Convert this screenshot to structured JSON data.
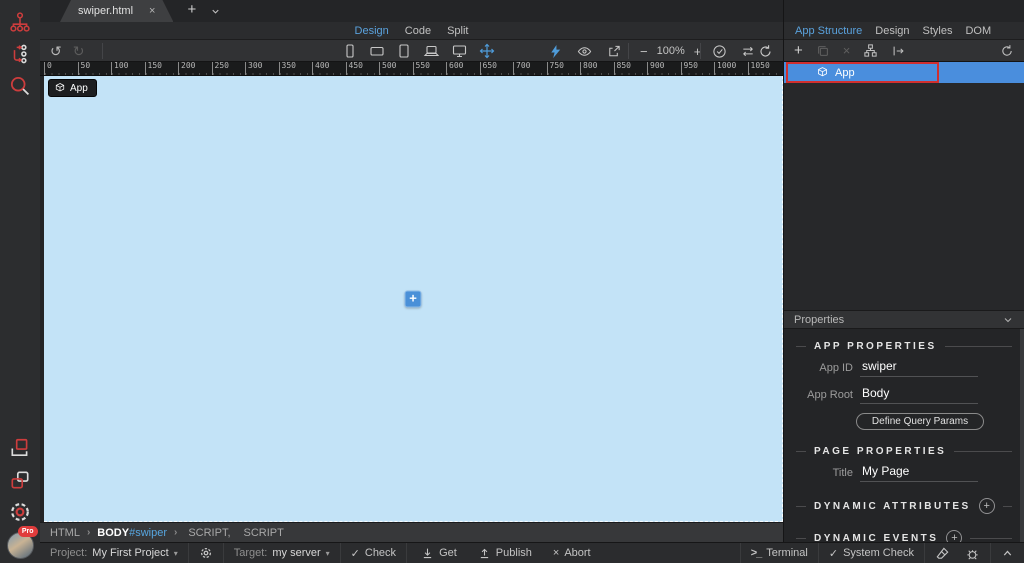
{
  "glyphs": {
    "close": "×",
    "plus": "+",
    "minus": "−",
    "check": "✓",
    "caret_down": "▾",
    "chevron_right": "›",
    "terminal_prompt": ">_",
    "abort_cross": "×",
    "undo": "↺",
    "redo": "↻"
  },
  "tab": {
    "title": "swiper.html"
  },
  "view_modes": {
    "items": [
      "Design",
      "Code",
      "Split"
    ],
    "active": "Design"
  },
  "toolbar": {
    "zoom_level": "100%"
  },
  "ruler": {
    "labels": [
      "0",
      "50",
      "100",
      "150",
      "200",
      "250",
      "300",
      "350",
      "400",
      "450",
      "500",
      "550",
      "600",
      "650",
      "700",
      "750",
      "800",
      "850",
      "900",
      "950",
      "1000",
      "1050"
    ]
  },
  "canvas": {
    "badge_label": "App"
  },
  "right_panel": {
    "tabs": [
      "App Structure",
      "Design",
      "Styles",
      "DOM"
    ],
    "active_tab": "App Structure",
    "tree": {
      "app_label": "App"
    },
    "properties_title": "Properties",
    "app_properties": {
      "heading": "APP PROPERTIES",
      "app_id_label": "App ID",
      "app_id_value": "swiper",
      "app_root_label": "App Root",
      "app_root_value": "Body",
      "define_query_params_label": "Define Query Params"
    },
    "page_properties": {
      "heading": "PAGE PROPERTIES",
      "title_label": "Title",
      "title_value": "My Page"
    },
    "dynamic_attributes": {
      "heading": "DYNAMIC ATTRIBUTES"
    },
    "dynamic_events": {
      "heading": "DYNAMIC EVENTS"
    }
  },
  "breadcrumb": {
    "html": "HTML",
    "body": "BODY",
    "body_id": "#swiper",
    "script_1": "SCRIPT,",
    "script_2": "SCRIPT"
  },
  "status_bar": {
    "project_label": "Project:",
    "project_value": "My First Project",
    "target_label": "Target:",
    "target_value": "my server",
    "check_label": "Check",
    "get_label": "Get",
    "publish_label": "Publish",
    "abort_label": "Abort",
    "terminal_label": "Terminal",
    "system_check_label": "System Check"
  },
  "sidebar": {
    "pro_badge": "Pro"
  },
  "colors": {
    "accent_blue": "#4f9cda",
    "selection_blue": "#4a8edd",
    "selection_red": "#d02f2f",
    "accent_red": "#cd3d3d",
    "canvas_blue": "#c3e3f7"
  }
}
